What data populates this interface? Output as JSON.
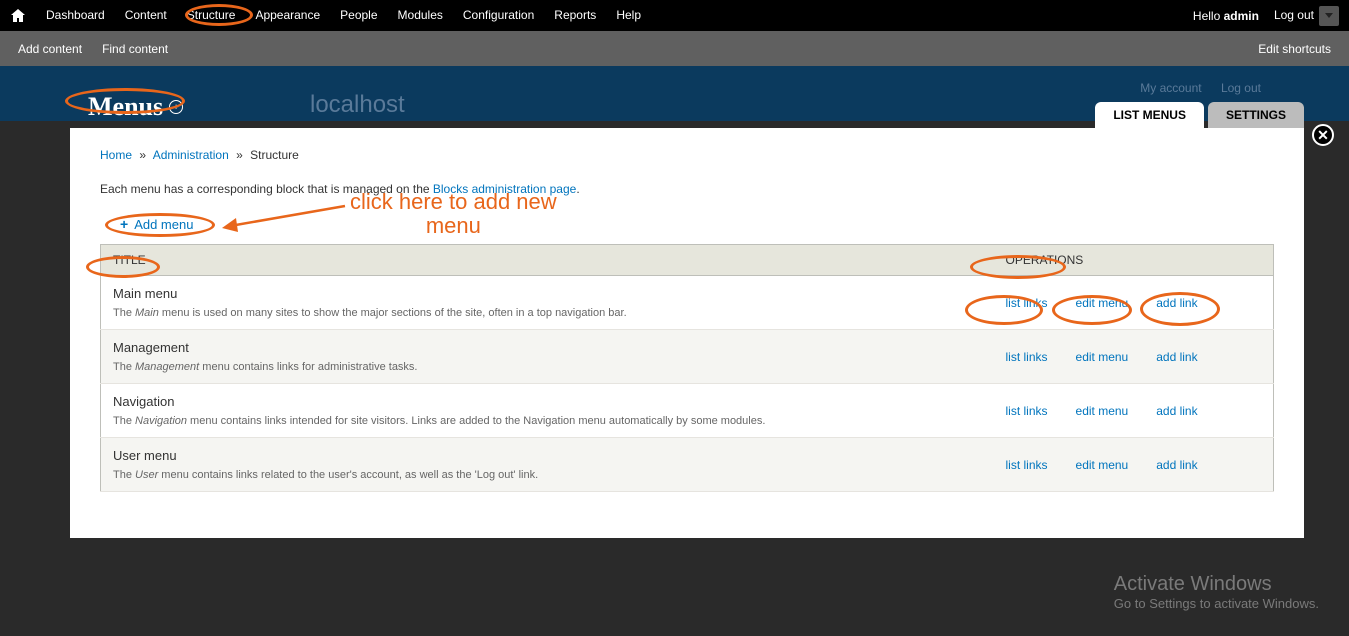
{
  "toolbar": {
    "items": [
      "Dashboard",
      "Content",
      "Structure",
      "Appearance",
      "People",
      "Modules",
      "Configuration",
      "Reports",
      "Help"
    ],
    "hello_prefix": "Hello ",
    "hello_user": "admin",
    "logout": "Log out"
  },
  "subtoolbar": {
    "items": [
      "Add content",
      "Find content"
    ],
    "edit_shortcuts": "Edit shortcuts"
  },
  "site_header": {
    "my_account": "My account",
    "logout": "Log out",
    "site_name": "localhost"
  },
  "overlay": {
    "title": "Menus",
    "tabs": {
      "list": "LIST MENUS",
      "settings": "SETTINGS"
    },
    "breadcrumb": {
      "home": "Home",
      "admin": "Administration",
      "structure": "Structure"
    },
    "help_text_pre": "Each menu has a corresponding block that is managed on the ",
    "help_text_link": "Blocks administration page",
    "help_text_post": ".",
    "add_menu": "Add menu"
  },
  "table": {
    "headers": {
      "title": "TITLE",
      "operations": "OPERATIONS"
    },
    "ops": {
      "list": "list links",
      "edit": "edit menu",
      "add": "add link"
    },
    "rows": [
      {
        "title": "Main menu",
        "desc_pre": "The ",
        "desc_em": "Main",
        "desc_post": " menu is used on many sites to show the major sections of the site, often in a top navigation bar."
      },
      {
        "title": "Management",
        "desc_pre": "The ",
        "desc_em": "Management",
        "desc_post": " menu contains links for administrative tasks."
      },
      {
        "title": "Navigation",
        "desc_pre": "The ",
        "desc_em": "Navigation",
        "desc_post": " menu contains links intended for site visitors. Links are added to the Navigation menu automatically by some modules."
      },
      {
        "title": "User menu",
        "desc_pre": "The ",
        "desc_em": "User",
        "desc_post": " menu contains links related to the user's account, as well as the 'Log out' link."
      }
    ]
  },
  "annotations": {
    "hint": "click here to add new menu"
  },
  "watermark": {
    "line1": "Activate Windows",
    "line2": "Go to Settings to activate Windows."
  }
}
